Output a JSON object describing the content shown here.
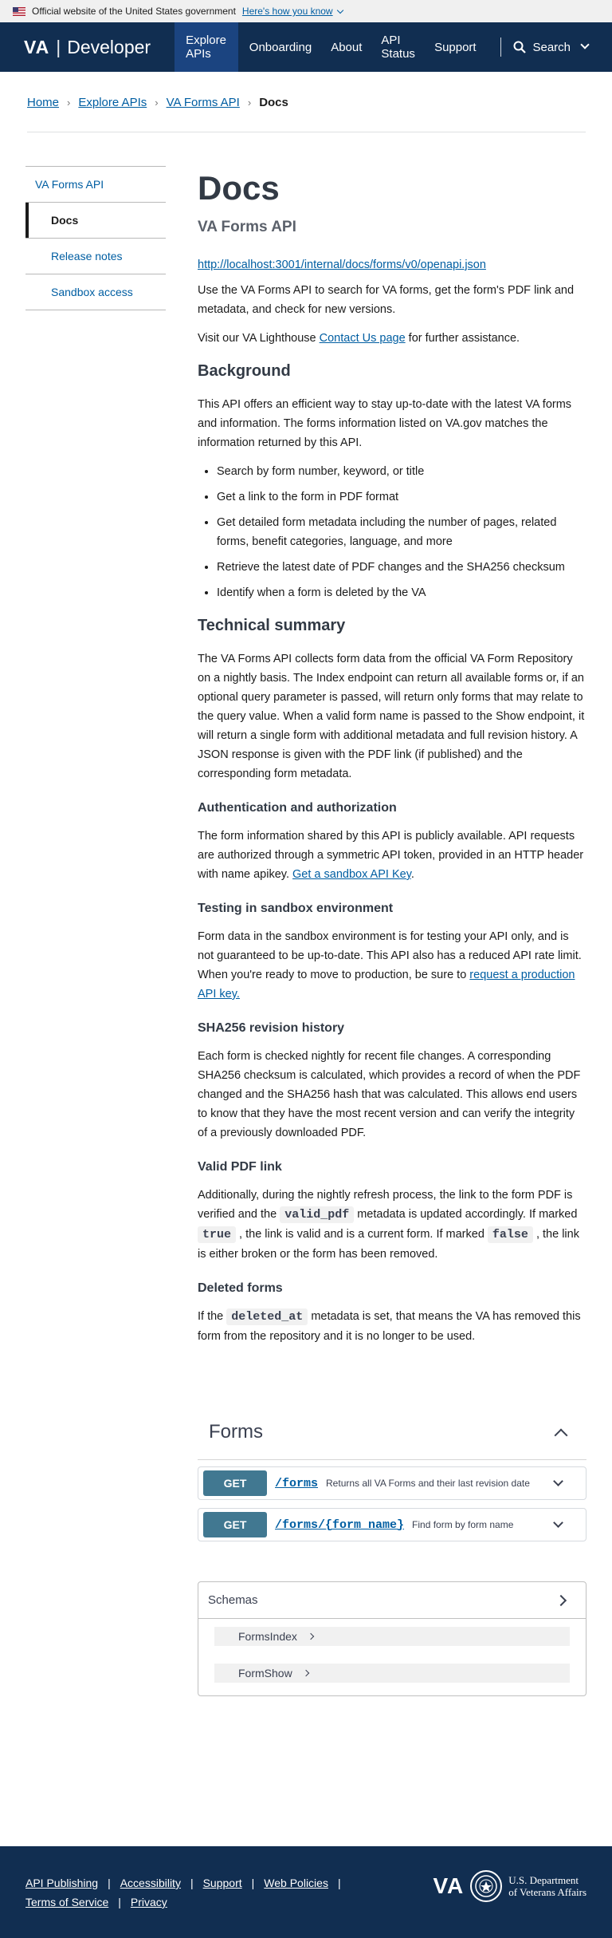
{
  "gov_banner": {
    "text": "Official website of the United States government",
    "link": "Here's how you know"
  },
  "header": {
    "logo_va": "VA",
    "logo_sep": "|",
    "logo_dev": "Developer",
    "nav": [
      "Explore APIs",
      "Onboarding",
      "About",
      "API Status",
      "Support"
    ],
    "search": "Search"
  },
  "breadcrumb": {
    "items": [
      "Home",
      "Explore APIs",
      "VA Forms API"
    ],
    "current": "Docs",
    "separator": "›"
  },
  "sidebar": {
    "items": [
      {
        "label": "VA Forms API"
      },
      {
        "label": "Docs"
      },
      {
        "label": "Release notes"
      },
      {
        "label": "Sandbox access"
      }
    ]
  },
  "content": {
    "title": "Docs",
    "subtitle": "VA Forms API",
    "spec_url": "http://localhost:3001/internal/docs/forms/v0/openapi.json",
    "intro": "Use the VA Forms API to search for VA forms, get the form's PDF link and metadata, and check for new versions.",
    "visit_pre": "Visit our VA Lighthouse ",
    "visit_link": "Contact Us page",
    "visit_post": " for further assistance.",
    "background_heading": "Background",
    "background_text": "This API offers an efficient way to stay up-to-date with the latest VA forms and information. The forms information listed on VA.gov matches the information returned by this API.",
    "bullets": [
      "Search by form number, keyword, or title",
      "Get a link to the form in PDF format",
      "Get detailed form metadata including the number of pages, related forms, benefit categories, language, and more",
      "Retrieve the latest date of PDF changes and the SHA256 checksum",
      "Identify when a form is deleted by the VA"
    ],
    "tech_heading": "Technical summary",
    "tech_text": "The VA Forms API collects form data from the official VA Form Repository on a nightly basis. The Index endpoint can return all available forms or, if an optional query parameter is passed, will return only forms that may relate to the query value. When a valid form name is passed to the Show endpoint, it will return a single form with additional metadata and full revision history. A JSON response is given with the PDF link (if published) and the corresponding form metadata.",
    "auth_heading": "Authentication and authorization",
    "auth_text": "The form information shared by this API is publicly available. API requests are authorized through a symmetric API token, provided in an HTTP header with name apikey. ",
    "auth_link": "Get a sandbox API Key",
    "auth_post": ".",
    "sandbox_heading": "Testing in sandbox environment",
    "sandbox_text": "Form data in the sandbox environment is for testing your API only, and is not guaranteed to be up-to-date. This API also has a reduced API rate limit. When you're ready to move to production, be sure to ",
    "sandbox_link": "request a production API key.",
    "sha_heading": "SHA256 revision history",
    "sha_text": "Each form is checked nightly for recent file changes. A corresponding SHA256 checksum is calculated, which provides a record of when the PDF changed and the SHA256 hash that was calculated. This allows end users to know that they have the most recent version and can verify the integrity of a previously downloaded PDF.",
    "pdf_heading": "Valid PDF link",
    "pdf_text_1": "Additionally, during the nightly refresh process, the link to the form PDF is verified and the ",
    "pdf_code_1": "valid_pdf",
    "pdf_text_2": " metadata is updated accordingly. If marked ",
    "pdf_code_2": "true",
    "pdf_text_3": " , the link is valid and is a current form. If marked ",
    "pdf_code_3": "false",
    "pdf_text_4": " , the link is either broken or the form has been removed.",
    "deleted_heading": "Deleted forms",
    "deleted_text_1": "If the ",
    "deleted_code": "deleted_at",
    "deleted_text_2": " metadata is set, that means the VA has removed this form from the repository and it is no longer to be used."
  },
  "swagger": {
    "tag": "Forms",
    "operations": [
      {
        "method": "GET",
        "path": "/forms",
        "summary": "Returns all VA Forms and their last revision date"
      },
      {
        "method": "GET",
        "path": "/forms/{form_name}",
        "summary": "Find form by form name"
      }
    ],
    "schemas_title": "Schemas",
    "schemas": [
      "FormsIndex",
      "FormShow"
    ]
  },
  "footer": {
    "links": [
      "API Publishing",
      "Accessibility",
      "Support",
      "Web Policies",
      "Terms of Service",
      "Privacy"
    ],
    "brand_va": "VA",
    "dept_line1": "U.S. Department",
    "dept_line2": "of Veterans Affairs"
  },
  "colors": {
    "header_bg": "#112e51",
    "nav_active": "#1b4480",
    "link": "#005ea2",
    "get_method": "#417891"
  }
}
